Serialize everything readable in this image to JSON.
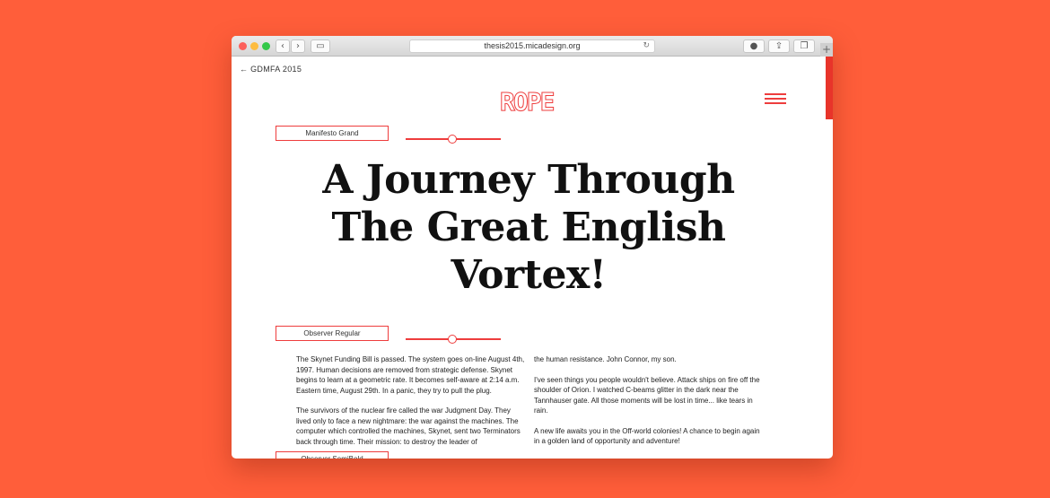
{
  "browser": {
    "url": "thesis2015.micadesign.org",
    "back_icon": "chevron-left",
    "forward_icon": "chevron-right",
    "sidebar_icon": "sidebar",
    "reload_icon": "reload",
    "download_icon": "download",
    "share_icon": "share",
    "tabs_icon": "tabs",
    "new_tab": "+"
  },
  "page": {
    "back_link": "← GDMFA 2015",
    "logo": "ROPE",
    "menu_icon": "hamburger",
    "accent": "#ee3d3d",
    "background": "#ff5e3a"
  },
  "specimens": [
    {
      "label": "Manifesto Grand"
    },
    {
      "label": "Observer Regular"
    },
    {
      "label": "Observer SemiBold"
    }
  ],
  "headline": [
    "A Journey Through",
    "The Great English",
    "Vortex!"
  ],
  "body": {
    "left": [
      "The Skynet Funding Bill is passed. The system goes on-line August 4th, 1997. Human decisions are removed from strategic defense. Skynet begins to learn at a geometric rate. It becomes self-aware at 2:14 a.m. Eastern time, August 29th. In a panic, they try to pull the plug.",
      "The survivors of the nuclear fire called the war Judgment Day. They lived only to face a new nightmare: the war against the machines. The computer which controlled the machines, Skynet, sent two Terminators back through time. Their mission: to destroy the leader of"
    ],
    "right": [
      "the human resistance. John Connor, my son.",
      "I've seen things you people wouldn't believe. Attack ships on fire off the shoulder of Orion. I watched C-beams glitter in the dark near the Tannhauser gate. All those moments will be lost in time... like tears in rain.",
      "A new life awaits you in the Off-world colonies! A chance to begin again in a golden land of opportunity and adventure!"
    ]
  }
}
